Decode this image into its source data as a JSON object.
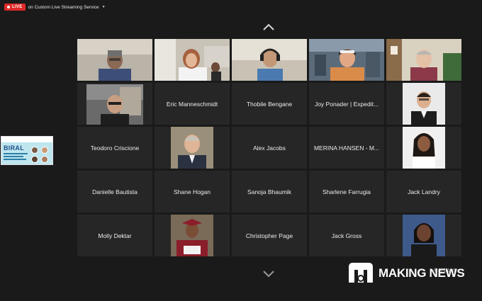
{
  "stream": {
    "live_label": "LIVE",
    "service_label": "on Custom Live Streaming Service"
  },
  "participants": [
    {
      "id": "p01",
      "name": "",
      "type": "video"
    },
    {
      "id": "p02",
      "name": "",
      "type": "video"
    },
    {
      "id": "p03",
      "name": "",
      "type": "video"
    },
    {
      "id": "p04",
      "name": "",
      "type": "video"
    },
    {
      "id": "p05",
      "name": "",
      "type": "video"
    },
    {
      "id": "p06",
      "name": "",
      "type": "video"
    },
    {
      "id": "p07",
      "name": "Eric Manneschmidt",
      "type": "name"
    },
    {
      "id": "p08",
      "name": "Thobile Bengane",
      "type": "name"
    },
    {
      "id": "p09",
      "name": "Joy Ponader | Expedit...",
      "type": "name"
    },
    {
      "id": "p10",
      "name": "",
      "type": "photo"
    },
    {
      "id": "p11",
      "name": "Teodoro Criscione",
      "type": "name"
    },
    {
      "id": "p12",
      "name": "",
      "type": "photo"
    },
    {
      "id": "p13",
      "name": "Alex Jacobs",
      "type": "name"
    },
    {
      "id": "p14",
      "name": "MERINA HANSEN - M...",
      "type": "name"
    },
    {
      "id": "p15",
      "name": "",
      "type": "photo"
    },
    {
      "id": "p16",
      "name": "Danielle Bautista",
      "type": "name"
    },
    {
      "id": "p17",
      "name": "Shane Hogan",
      "type": "name"
    },
    {
      "id": "p18",
      "name": "Sanoja Bhaumik",
      "type": "name"
    },
    {
      "id": "p19",
      "name": "Sharlene Farrugia",
      "type": "name"
    },
    {
      "id": "p20",
      "name": "Jack Landry",
      "type": "name"
    },
    {
      "id": "p21",
      "name": "Molly Dektar",
      "type": "name"
    },
    {
      "id": "p22",
      "name": "",
      "type": "photo"
    },
    {
      "id": "p23",
      "name": "Christopher Page",
      "type": "name"
    },
    {
      "id": "p24",
      "name": "Jack Gross",
      "type": "name"
    },
    {
      "id": "p25",
      "name": "",
      "type": "photo"
    }
  ],
  "shared_screen": {
    "title": "BIRAL"
  },
  "watermark": {
    "brand": "MAKING NEWS",
    "korean": "메이킹뉴스"
  },
  "icons": {
    "up": "chevron-up-icon",
    "down": "chevron-down-icon",
    "caret": "caret-down-icon"
  },
  "colors": {
    "live": "#e02828",
    "tile": "#262626",
    "background": "#1a1a1a"
  }
}
